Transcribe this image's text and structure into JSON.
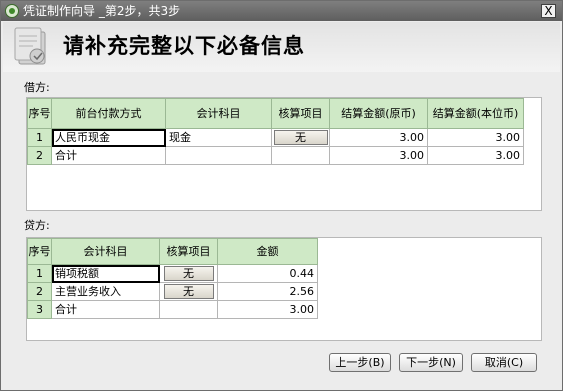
{
  "window": {
    "title": "凭证制作向导 _第2步，共3步",
    "close_label": "X"
  },
  "header": {
    "heading": "请补充完整以下必备信息"
  },
  "debit": {
    "section_label": "借方:",
    "columns": [
      "序号",
      "前台付款方式",
      "会计科目",
      "核算项目",
      "结算金额(原币)",
      "结算金额(本位币)"
    ],
    "rows": [
      {
        "seq": "1",
        "payment_method": "人民币现金",
        "account": "现金",
        "accounting_item": "无",
        "amount_original": "3.00",
        "amount_base": "3.00"
      },
      {
        "seq": "2",
        "payment_method": "合计",
        "account": "",
        "accounting_item": "",
        "amount_original": "3.00",
        "amount_base": "3.00"
      }
    ]
  },
  "credit": {
    "section_label": "贷方:",
    "columns": [
      "序号",
      "会计科目",
      "核算项目",
      "金额"
    ],
    "rows": [
      {
        "seq": "1",
        "account": "销项税额",
        "accounting_item": "无",
        "amount": "0.44"
      },
      {
        "seq": "2",
        "account": "主营业务收入",
        "accounting_item": "无",
        "amount": "2.56"
      },
      {
        "seq": "3",
        "account": "合计",
        "accounting_item": "",
        "amount": "3.00"
      }
    ]
  },
  "buttons": {
    "prev": "上一步(B)",
    "next": "下一步(N)",
    "cancel": "取消(C)"
  },
  "colors": {
    "header_cell": "#cfe9c6",
    "titlebar": "#6b6b6b",
    "window_bg": "#ececec"
  }
}
